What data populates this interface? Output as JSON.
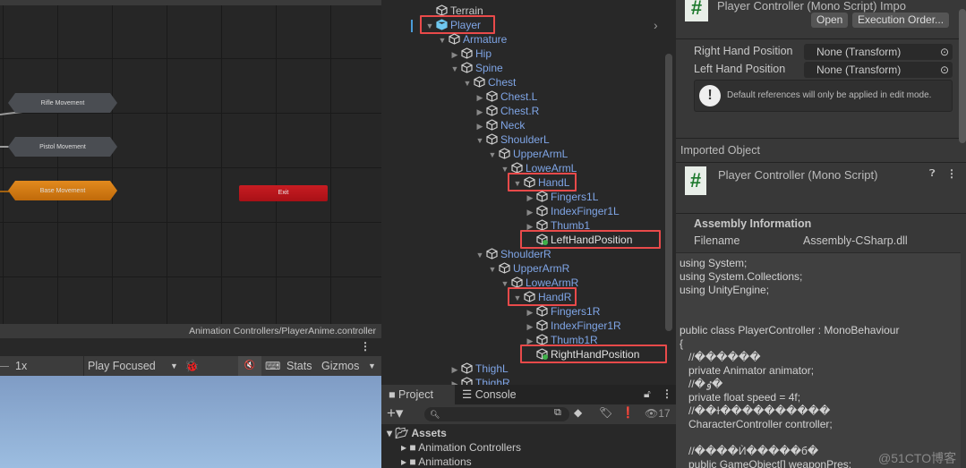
{
  "animator": {
    "states": [
      {
        "label": "Rifle Movement",
        "kind": "normal"
      },
      {
        "label": "Pistol Movement",
        "kind": "normal"
      },
      {
        "label": "Base Movement",
        "kind": "default"
      }
    ],
    "exit_label": "Exit",
    "breadcrumb": "Animation Controllers/PlayerAnime.controller"
  },
  "game_toolbar": {
    "scale": "1x",
    "play_mode": "Play Focused",
    "stats": "Stats",
    "gizmos": "Gizmos"
  },
  "hierarchy": {
    "rows": [
      {
        "label": "Terrain",
        "depth": 0,
        "arrow": "",
        "highlight": false,
        "script": false
      },
      {
        "label": "Player",
        "depth": 0,
        "arrow": "down",
        "highlight": true,
        "script": false,
        "prefab": true
      },
      {
        "label": "Armature",
        "depth": 1,
        "arrow": "down",
        "highlight": false
      },
      {
        "label": "Hip",
        "depth": 2,
        "arrow": "right",
        "highlight": false
      },
      {
        "label": "Spine",
        "depth": 2,
        "arrow": "down",
        "highlight": false
      },
      {
        "label": "Chest",
        "depth": 3,
        "arrow": "down",
        "highlight": false
      },
      {
        "label": "Chest.L",
        "depth": 4,
        "arrow": "right",
        "highlight": false
      },
      {
        "label": "Chest.R",
        "depth": 4,
        "arrow": "right",
        "highlight": false
      },
      {
        "label": "Neck",
        "depth": 4,
        "arrow": "right",
        "highlight": false
      },
      {
        "label": "ShoulderL",
        "depth": 4,
        "arrow": "down",
        "highlight": false
      },
      {
        "label": "UpperArmL",
        "depth": 5,
        "arrow": "down",
        "highlight": false
      },
      {
        "label": "LoweArmL",
        "depth": 6,
        "arrow": "down",
        "highlight": false
      },
      {
        "label": "HandL",
        "depth": 7,
        "arrow": "down",
        "highlight": true
      },
      {
        "label": "Fingers1L",
        "depth": 8,
        "arrow": "right",
        "highlight": false
      },
      {
        "label": "IndexFinger1L",
        "depth": 8,
        "arrow": "right",
        "highlight": false
      },
      {
        "label": "Thumb1",
        "depth": 8,
        "arrow": "right",
        "highlight": false
      },
      {
        "label": "LeftHandPosition",
        "depth": 8,
        "arrow": "",
        "highlight": true,
        "script": true
      },
      {
        "label": "ShoulderR",
        "depth": 4,
        "arrow": "down",
        "highlight": false
      },
      {
        "label": "UpperArmR",
        "depth": 5,
        "arrow": "down",
        "highlight": false
      },
      {
        "label": "LoweArmR",
        "depth": 6,
        "arrow": "down",
        "highlight": false
      },
      {
        "label": "HandR",
        "depth": 7,
        "arrow": "down",
        "highlight": true
      },
      {
        "label": "Fingers1R",
        "depth": 8,
        "arrow": "right",
        "highlight": false
      },
      {
        "label": "IndexFinger1R",
        "depth": 8,
        "arrow": "right",
        "highlight": false
      },
      {
        "label": "Thumb1R",
        "depth": 8,
        "arrow": "right",
        "highlight": false
      },
      {
        "label": "RightHandPosition",
        "depth": 8,
        "arrow": "",
        "highlight": true,
        "script": true
      },
      {
        "label": "ThighL",
        "depth": 2,
        "arrow": "right",
        "highlight": false
      },
      {
        "label": "ThighR",
        "depth": 2,
        "arrow": "right",
        "highlight": false
      }
    ]
  },
  "project": {
    "tabs": [
      "Project",
      "Console"
    ],
    "hidden_count": "17",
    "tree": [
      {
        "label": "Assets",
        "depth": 0
      },
      {
        "label": "Animation Controllers",
        "depth": 1
      },
      {
        "label": "Animations",
        "depth": 1
      }
    ]
  },
  "inspector": {
    "title": "Player Controller (Mono Script) Impo",
    "open_label": "Open",
    "execution_order_label": "Execution Order...",
    "fields": [
      {
        "label": "Right Hand Position",
        "value": "None (Transform)"
      },
      {
        "label": "Left Hand Position",
        "value": "None (Transform)"
      }
    ],
    "help_text": "Default references will only be applied in edit mode.",
    "imported_object": "Imported Object",
    "script_title": "Player Controller (Mono Script)",
    "assembly_heading": "Assembly Information",
    "filename_label": "Filename",
    "filename_value": "Assembly-CSharp.dll",
    "code": [
      "using System;",
      "using System.Collections;",
      "using UnityEngine;",
      "",
      "",
      "public class PlayerController : MonoBehaviour",
      "{",
      "   //������",
      "   private Animator animator;",
      "   //�ٶ�",
      "   private float speed = 4f;",
      "   //��ɫ����������",
      "   CharacterController controller;",
      "",
      "   //����Ѝ�����б�",
      "   public GameObject[] weaponPres;"
    ],
    "watermark": "@51CTO博客"
  },
  "colors": {
    "highlight": "#e94a4a",
    "base_state": "#d9790f",
    "exit_state": "#b8141a",
    "node_gray": "#4a4d52",
    "tree_text": "#7fa5e6"
  }
}
